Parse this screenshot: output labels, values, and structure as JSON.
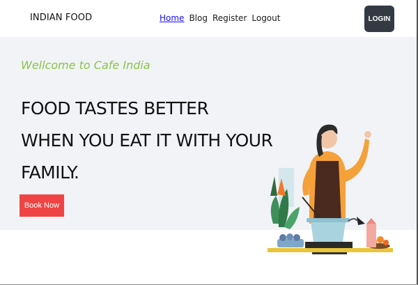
{
  "navbar": {
    "brand": "INDIAN FOOD",
    "links": [
      "Home",
      "Blog",
      "Register",
      "Logout"
    ],
    "login_label": "LOGIN"
  },
  "hero": {
    "tagline": "Wellcome to Cafe India",
    "headline_lines": [
      "FOOD TASTES BETTER",
      "WHEN YOU EAT IT WITH YOUR",
      "FAMILY."
    ],
    "book_label": "Book Now"
  },
  "colors": {
    "tagline": "#8bc34a",
    "book_button": "#f04444",
    "login_button": "#343a44",
    "hero_background": "#f1f3f6",
    "active_link": "#1a0dff"
  },
  "icons": {
    "illustration": "chef-cooking-illustration"
  }
}
